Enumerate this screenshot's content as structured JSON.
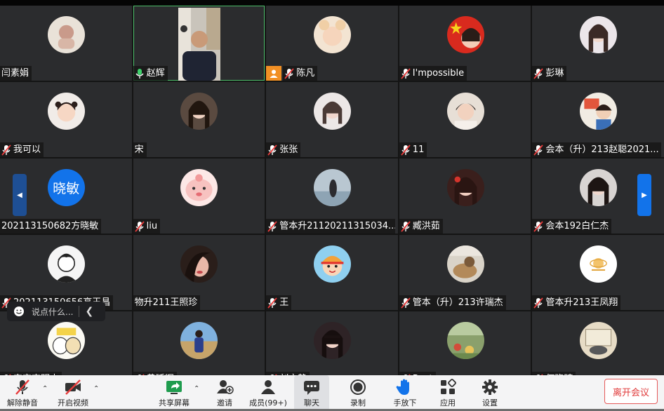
{
  "participants": [
    {
      "name": "闫素娟"
    },
    {
      "name": "赵辉"
    },
    {
      "name": "陈凡"
    },
    {
      "name": "I'mpossible"
    },
    {
      "name": "彭琳"
    },
    {
      "name": "我可以"
    },
    {
      "name": "宋"
    },
    {
      "name": "张张"
    },
    {
      "name": "11"
    },
    {
      "name": "会本（升）213赵聪2021..."
    },
    {
      "name": "202113150682方晓敏",
      "avatar_text": "晓敏"
    },
    {
      "name": "liu"
    },
    {
      "name": "管本升21120211315034..."
    },
    {
      "name": "臧洪茹"
    },
    {
      "name": "会本192白仁杰"
    },
    {
      "name": "202113150656高玉昌"
    },
    {
      "name": "物升211王照珍"
    },
    {
      "name": "王"
    },
    {
      "name": "管本（升）213许瑞杰"
    },
    {
      "name": "管本升213王凤翔"
    },
    {
      "name": "宫交李明杰"
    },
    {
      "name": "黄延辉"
    },
    {
      "name": "刘文静"
    },
    {
      "name": "Best"
    },
    {
      "name": "何晓晴"
    }
  ],
  "chat_input": {
    "placeholder": "说点什么..."
  },
  "toolbar": {
    "unmute": "解除静音",
    "start_video": "开启视频",
    "share_screen": "共享屏幕",
    "invite": "邀请",
    "members": "成员(99+)",
    "chat": "聊天",
    "record": "录制",
    "raise_hand": "手放下",
    "apps": "应用",
    "settings": "设置",
    "leave": "离开会议"
  },
  "colors": {
    "accent": "#1273ea",
    "host_badge": "#f29024",
    "leave": "#e03a3a",
    "tile_bg": "#2b2c2e"
  }
}
